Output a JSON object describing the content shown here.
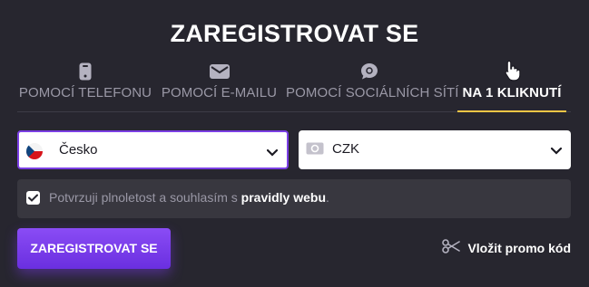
{
  "title": "ZAREGISTROVAT SE",
  "tabs": [
    {
      "label": "POMOCÍ TELEFONU",
      "icon": "phone-icon",
      "active": false
    },
    {
      "label": "POMOCÍ E-MAILU",
      "icon": "envelope-icon",
      "active": false
    },
    {
      "label": "POMOCÍ SOCIÁLNÍCH SÍTÍ",
      "icon": "chat-bubble-icon",
      "active": false
    },
    {
      "label": "NA 1 KLIKNUTÍ",
      "icon": "pointer-hand-icon",
      "active": true
    }
  ],
  "country": {
    "value": "Česko",
    "icon": "czech-flag-icon"
  },
  "currency": {
    "value": "CZK",
    "icon": "cash-icon"
  },
  "consent": {
    "checked": true,
    "text": "Potvrzuji plnoletost a souhlasím s ",
    "link": "pravidly webu",
    "suffix": "."
  },
  "register_button": "ZAREGISTROVAT SE",
  "promo": {
    "label": "Vložit promo kód",
    "icon": "scissors-icon"
  },
  "colors": {
    "background": "#27262f",
    "accent": "#7b3fe4",
    "active_tab_underline": "#f6c545",
    "muted_text": "#9a98a6"
  }
}
